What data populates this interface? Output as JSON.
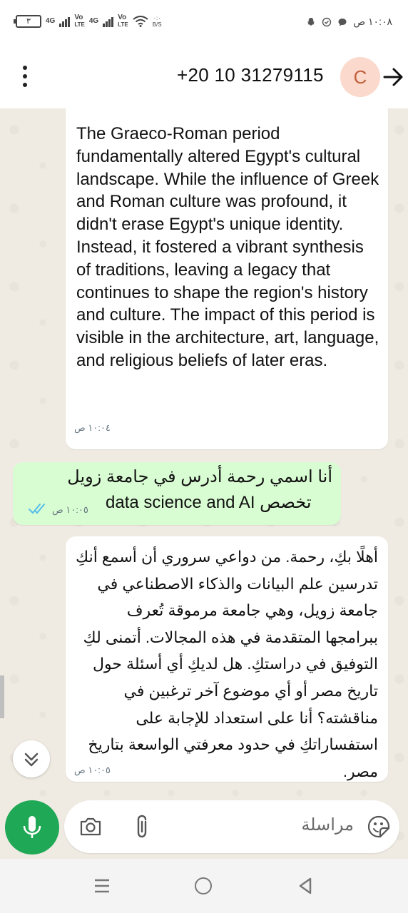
{
  "status_bar": {
    "battery": "٣",
    "signal1": "4G",
    "volte1_top": "Vo",
    "volte1_bottom": "LTE",
    "signal2": "4G",
    "volte2_top": "Vo",
    "volte2_bottom": "LTE",
    "speed_top": "٠:٠",
    "speed_bottom": "B/S",
    "time": "١٠:٠٨ ص"
  },
  "header": {
    "contact": "+20 10 31279115",
    "avatar_letter": "C"
  },
  "messages": [
    {
      "direction": "incoming",
      "text": "The Graeco-Roman period fundamentally altered Egypt's cultural landscape. While the influence of Greek and Roman culture was profound, it didn't erase Egypt's unique identity. Instead, it fostered a vibrant synthesis of traditions, leaving a legacy that continues to shape the region's history and culture.  The impact of this period is visible in the architecture, art, language, and religious beliefs of later eras.",
      "time": "١٠:٠٤ ص"
    },
    {
      "direction": "outgoing",
      "line1": "أنا اسمي رحمة أدرس في جامعة زويل",
      "line2": "تخصص data science and AI",
      "time": "١٠:٠٥ ص",
      "status": "read"
    },
    {
      "direction": "incoming",
      "text": "أهلًا بكِ، رحمة.  من دواعي سروري أن أسمع أنكِ تدرسين علم البيانات والذكاء الاصطناعي في جامعة زويل، وهي جامعة مرموقة تُعرف ببرامجها المتقدمة في هذه المجالات.  أتمنى لكِ التوفيق في دراستكِ. هل لديكِ أي أسئلة حول تاريخ مصر أو أي موضوع آخر ترغبين في مناقشته؟  أنا على استعداد للإجابة على استفساراتكِ في حدود معرفتي الواسعة بتاريخ مصر.",
      "time": "١٠:٠٥ ص"
    }
  ],
  "input": {
    "placeholder": "مراسلة"
  },
  "colors": {
    "accent_green": "#1fa855",
    "outgoing_bubble": "#d9fdd3",
    "read_ticks": "#53bdeb",
    "avatar_bg": "#fbd9cc"
  }
}
